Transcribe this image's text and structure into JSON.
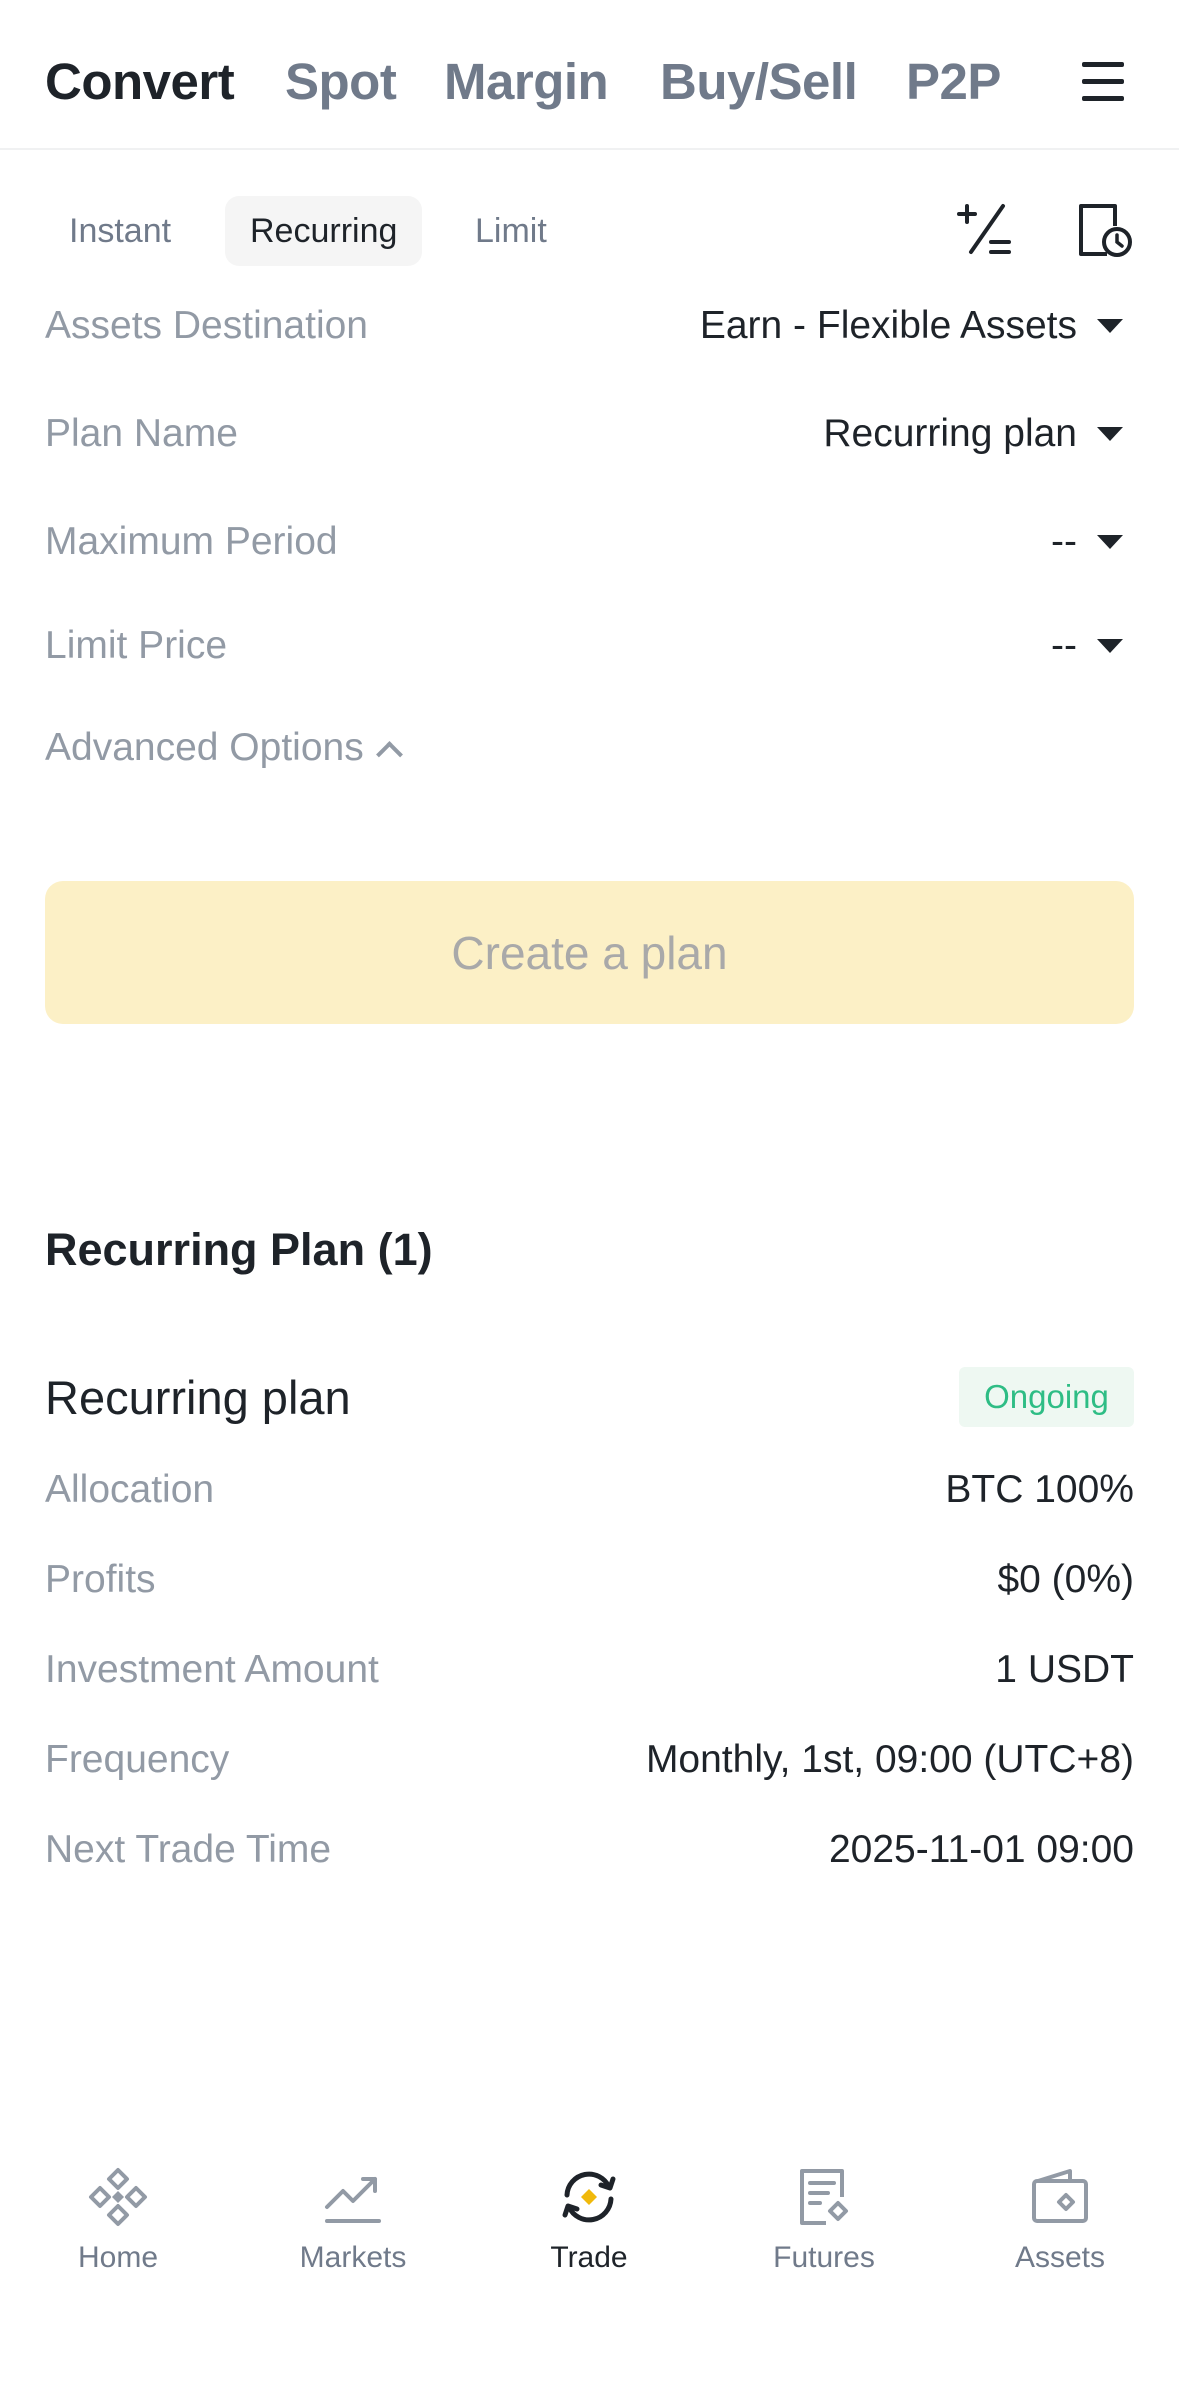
{
  "top_tabs": [
    "Convert",
    "Spot",
    "Margin",
    "Buy/Sell",
    "P2P"
  ],
  "active_top_tab": "Convert",
  "sub_tabs": [
    "Instant",
    "Recurring",
    "Limit"
  ],
  "active_sub_tab": "Recurring",
  "form": {
    "assets_destination": {
      "label": "Assets Destination",
      "value": "Earn - Flexible Assets"
    },
    "plan_name": {
      "label": "Plan Name",
      "value": "Recurring plan"
    },
    "maximum_period": {
      "label": "Maximum Period",
      "value": "--"
    },
    "limit_price": {
      "label": "Limit Price",
      "value": "--"
    },
    "advanced_options": "Advanced Options",
    "create_button": "Create a plan"
  },
  "plans_section": {
    "title": "Recurring Plan (1)",
    "plan": {
      "name": "Recurring plan",
      "status": "Ongoing",
      "details": [
        {
          "label": "Allocation",
          "value": "BTC 100%"
        },
        {
          "label": "Profits",
          "value": "$0 (0%)"
        },
        {
          "label": "Investment Amount",
          "value": "1 USDT"
        },
        {
          "label": "Frequency",
          "value": "Monthly, 1st, 09:00 (UTC+8)"
        },
        {
          "label": "Next Trade Time",
          "value": "2025-11-01 09:00"
        }
      ]
    }
  },
  "bottom_nav": [
    {
      "label": "Home",
      "icon": "binance-logo-icon"
    },
    {
      "label": "Markets",
      "icon": "chart-line-icon"
    },
    {
      "label": "Trade",
      "icon": "trade-swap-icon"
    },
    {
      "label": "Futures",
      "icon": "futures-document-icon"
    },
    {
      "label": "Assets",
      "icon": "wallet-icon"
    }
  ],
  "active_bottom_nav": "Trade",
  "colors": {
    "brand_yellow": "#f0b90b",
    "button_disabled_bg": "#fcf0c6",
    "status_green": "#2ebd85",
    "text_primary": "#1e2329",
    "text_secondary": "#929aa5"
  }
}
